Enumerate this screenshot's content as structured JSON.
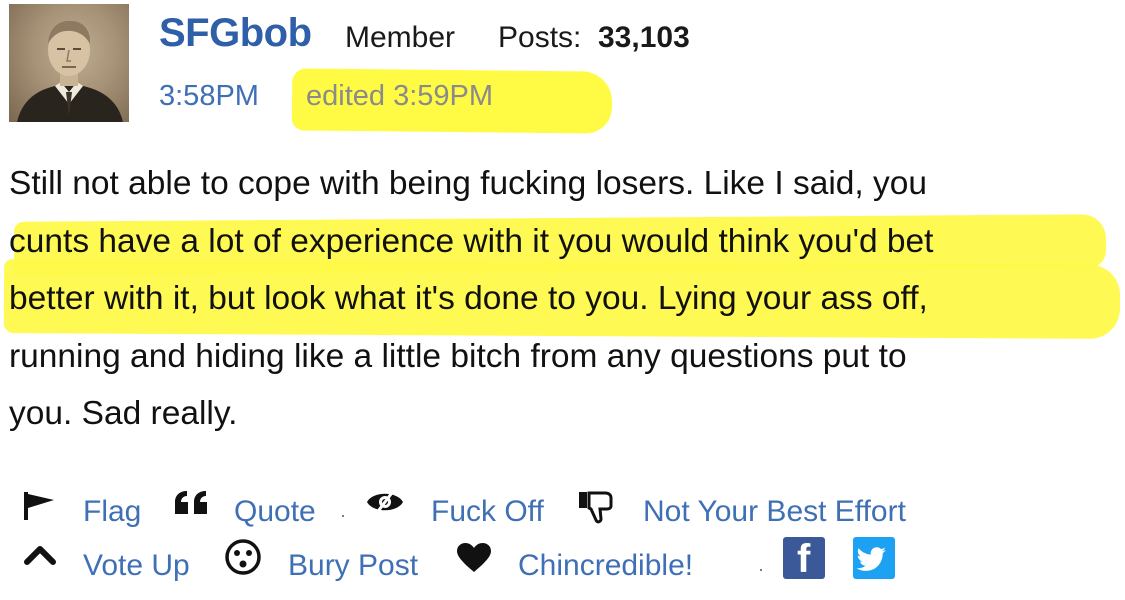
{
  "post": {
    "author": {
      "username": "SFGbob",
      "role": "Member",
      "posts_label": "Posts:",
      "posts_count": "33,103"
    },
    "timestamp": "3:58PM",
    "edited": "edited 3:59PM",
    "body_lines": [
      "Still not able to cope with being fucking losers. Like I said, you",
      "cunts have a lot of experience with it you would think you'd bet",
      "better with it, but look what it's done to you. Lying your ass off,",
      "running and hiding like a little bitch from any questions put to",
      "you. Sad really."
    ]
  },
  "actions": {
    "flag": "Flag",
    "quote": "Quote",
    "fuck_off": "Fuck Off",
    "not_best_effort": "Not Your Best Effort",
    "vote_up": "Vote Up",
    "bury_post": "Bury Post",
    "chincredible": "Chincredible!",
    "separator": "·",
    "facebook_glyph": "f"
  },
  "colors": {
    "username": "#2f5fa8",
    "link": "#3f6fb5",
    "highlight": "#fffb3b",
    "facebook": "#3b5998",
    "twitter": "#1da1f2"
  },
  "icons": [
    "flag-icon",
    "quote-icon",
    "fuck-off-icon",
    "thumbs-down-icon",
    "vote-up-icon",
    "bury-post-icon",
    "heart-icon",
    "facebook-icon",
    "twitter-icon"
  ]
}
